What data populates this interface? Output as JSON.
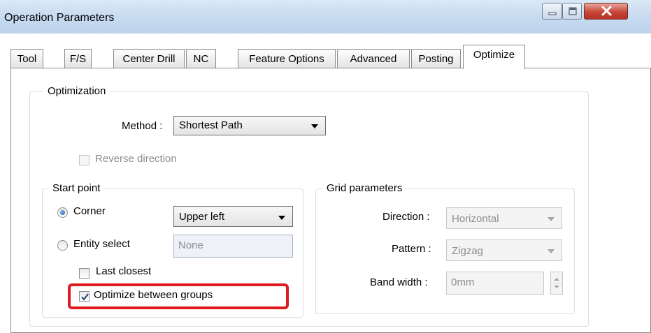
{
  "window": {
    "title": "Operation Parameters"
  },
  "tabs": [
    {
      "label": "Tool"
    },
    {
      "label": "F/S"
    },
    {
      "label": "Center Drill"
    },
    {
      "label": "NC"
    },
    {
      "label": "Feature Options"
    },
    {
      "label": "Advanced"
    },
    {
      "label": "Posting"
    },
    {
      "label": "Optimize",
      "active": true
    }
  ],
  "optimization": {
    "legend": "Optimization",
    "method_label": "Method :",
    "method_value": "Shortest Path",
    "reverse_direction_label": "Reverse direction",
    "reverse_direction_checked": false
  },
  "start_point": {
    "legend": "Start point",
    "corner_label": "Corner",
    "corner_selected": true,
    "corner_value": "Upper left",
    "entity_select_label": "Entity select",
    "entity_select_value": "None",
    "last_closest_label": "Last closest",
    "last_closest_checked": false,
    "optimize_between_groups_label": "Optimize between groups",
    "optimize_between_groups_checked": true
  },
  "grid_parameters": {
    "legend": "Grid parameters",
    "direction_label": "Direction :",
    "direction_value": "Horizontal",
    "pattern_label": "Pattern :",
    "pattern_value": "Zigzag",
    "band_width_label": "Band width :",
    "band_width_value": "0mm"
  },
  "colors": {
    "highlight": "#e0191e",
    "radio_accent": "#1d5fa9"
  }
}
